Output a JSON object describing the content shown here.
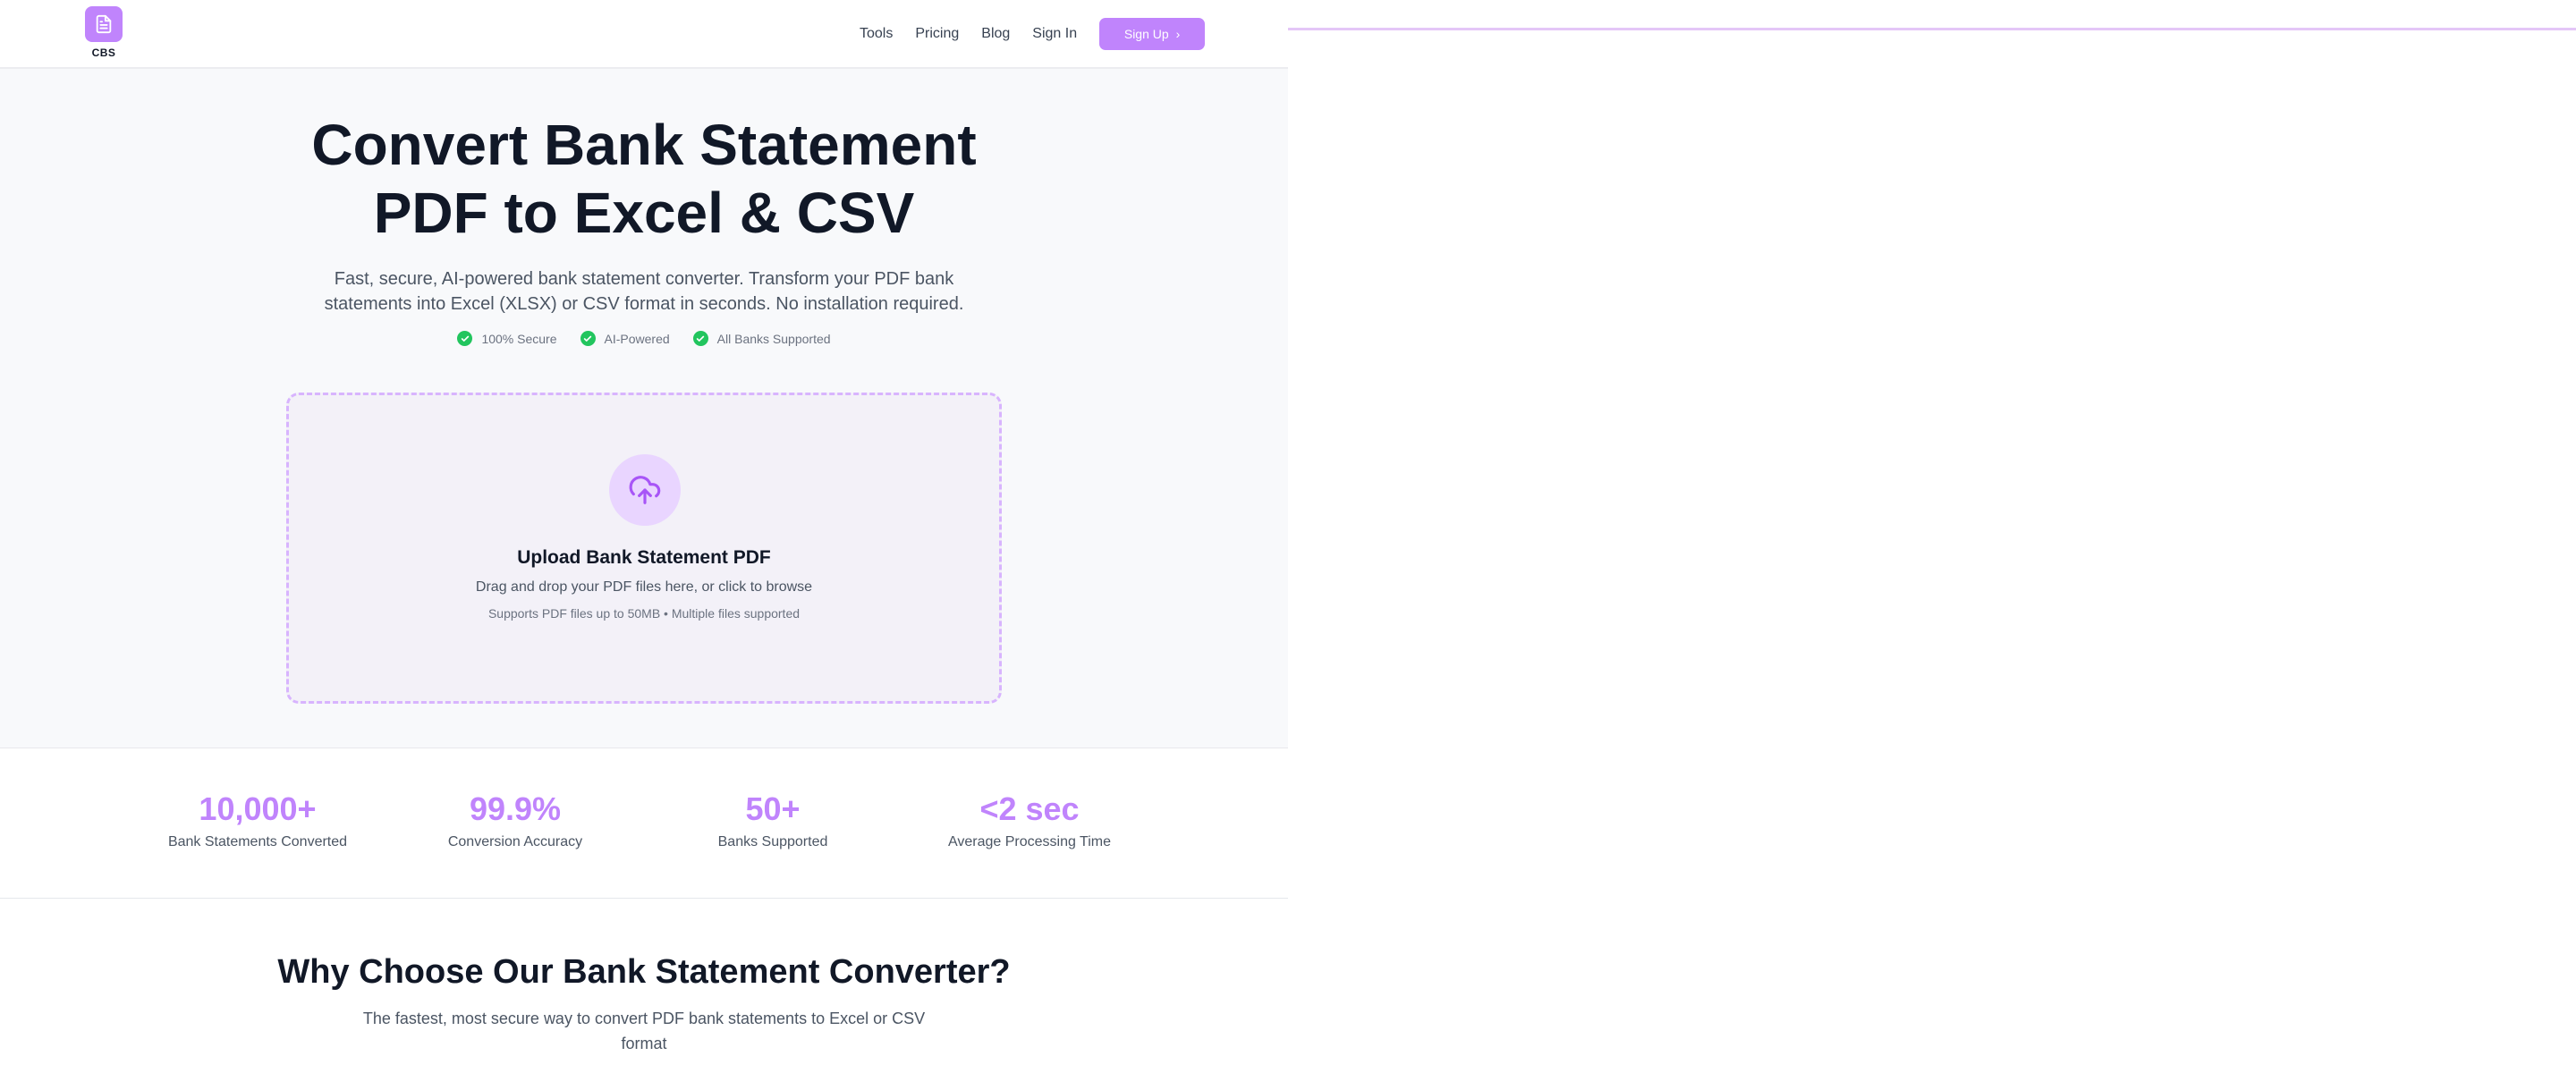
{
  "brand": {
    "logo_text": "CBS"
  },
  "nav": {
    "links": [
      "Tools",
      "Pricing",
      "Blog",
      "Sign In"
    ],
    "signup_label": "Sign Up"
  },
  "hero": {
    "title_line1": "Convert Bank Statement",
    "title_line2": "PDF to Excel & CSV",
    "subtitle": "Fast, secure, AI-powered bank statement converter. Transform your PDF bank statements into Excel (XLSX) or CSV format in seconds. No installation required.",
    "badges": [
      "100% Secure",
      "AI-Powered",
      "All Banks Supported"
    ]
  },
  "upload": {
    "title": "Upload Bank Statement PDF",
    "description": "Drag and drop your PDF files here, or click to browse",
    "note": "Supports PDF files up to 50MB • Multiple files supported"
  },
  "stats": [
    {
      "value": "10,000+",
      "label": "Bank Statements Converted"
    },
    {
      "value": "99.9%",
      "label": "Conversion Accuracy"
    },
    {
      "value": "50+",
      "label": "Banks Supported"
    },
    {
      "value": "<2 sec",
      "label": "Average Processing Time"
    }
  ],
  "why": {
    "title": "Why Choose Our Bank Statement Converter?",
    "subtitle": "The fastest, most secure way to convert PDF bank statements to Excel or CSV format"
  },
  "colors": {
    "accent": "#c084fc",
    "accent_light": "#e9d5ff",
    "success": "#22c55e",
    "hero_bg": "#f8f9fb"
  },
  "icons": {
    "logo": "document-icon",
    "badge": "check-circle-icon",
    "upload": "cloud-upload-icon",
    "signup": "chevron-right-icon"
  }
}
